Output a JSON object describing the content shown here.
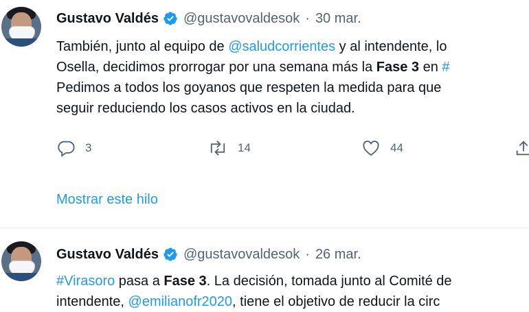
{
  "tweets": [
    {
      "author_name": "Gustavo Valdés",
      "handle": "@gustavovaldesok",
      "separator": "·",
      "date": "30 mar.",
      "lines": [
        {
          "pre": "También, junto al equipo de ",
          "link": "@saludcorrientes",
          "post": " y al intendente, lo"
        },
        {
          "pre": "Osella, decidimos prorrogar por una semana más la ",
          "bold": "Fase 3",
          "mid": " en ",
          "link": "#"
        },
        {
          "pre": "Pedimos a todos los goyanos que respeten la medida para que"
        },
        {
          "pre": "seguir reduciendo los casos activos en la ciudad."
        }
      ],
      "replies": "3",
      "retweets": "14",
      "likes": "44",
      "show_thread": "Mostrar este hilo"
    },
    {
      "author_name": "Gustavo Valdés",
      "handle": "@gustavovaldesok",
      "separator": "·",
      "date": "26 mar.",
      "lines": [
        {
          "link": "#Virasoro",
          "pre": " pasa a ",
          "bold": "Fase 3",
          "post": ". La decisión, tomada junto al Comité de"
        },
        {
          "pre": "intendente, ",
          "link": "@emilianofr2020",
          "post": ", tiene el objetivo de reducir la circ"
        }
      ]
    }
  ],
  "colors": {
    "link": "#1d9bf0",
    "secondary": "#536471",
    "verified": "#1d9bf0"
  }
}
